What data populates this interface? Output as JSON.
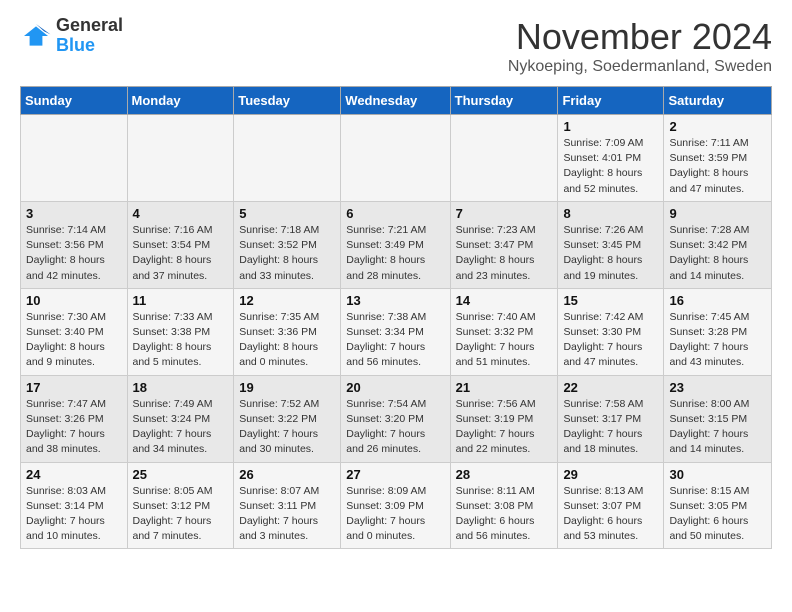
{
  "header": {
    "logo_line1": "General",
    "logo_line2": "Blue",
    "month_title": "November 2024",
    "location": "Nykoeping, Soedermanland, Sweden"
  },
  "weekdays": [
    "Sunday",
    "Monday",
    "Tuesday",
    "Wednesday",
    "Thursday",
    "Friday",
    "Saturday"
  ],
  "weeks": [
    [
      {
        "day": "",
        "info": ""
      },
      {
        "day": "",
        "info": ""
      },
      {
        "day": "",
        "info": ""
      },
      {
        "day": "",
        "info": ""
      },
      {
        "day": "",
        "info": ""
      },
      {
        "day": "1",
        "info": "Sunrise: 7:09 AM\nSunset: 4:01 PM\nDaylight: 8 hours and 52 minutes."
      },
      {
        "day": "2",
        "info": "Sunrise: 7:11 AM\nSunset: 3:59 PM\nDaylight: 8 hours and 47 minutes."
      }
    ],
    [
      {
        "day": "3",
        "info": "Sunrise: 7:14 AM\nSunset: 3:56 PM\nDaylight: 8 hours and 42 minutes."
      },
      {
        "day": "4",
        "info": "Sunrise: 7:16 AM\nSunset: 3:54 PM\nDaylight: 8 hours and 37 minutes."
      },
      {
        "day": "5",
        "info": "Sunrise: 7:18 AM\nSunset: 3:52 PM\nDaylight: 8 hours and 33 minutes."
      },
      {
        "day": "6",
        "info": "Sunrise: 7:21 AM\nSunset: 3:49 PM\nDaylight: 8 hours and 28 minutes."
      },
      {
        "day": "7",
        "info": "Sunrise: 7:23 AM\nSunset: 3:47 PM\nDaylight: 8 hours and 23 minutes."
      },
      {
        "day": "8",
        "info": "Sunrise: 7:26 AM\nSunset: 3:45 PM\nDaylight: 8 hours and 19 minutes."
      },
      {
        "day": "9",
        "info": "Sunrise: 7:28 AM\nSunset: 3:42 PM\nDaylight: 8 hours and 14 minutes."
      }
    ],
    [
      {
        "day": "10",
        "info": "Sunrise: 7:30 AM\nSunset: 3:40 PM\nDaylight: 8 hours and 9 minutes."
      },
      {
        "day": "11",
        "info": "Sunrise: 7:33 AM\nSunset: 3:38 PM\nDaylight: 8 hours and 5 minutes."
      },
      {
        "day": "12",
        "info": "Sunrise: 7:35 AM\nSunset: 3:36 PM\nDaylight: 8 hours and 0 minutes."
      },
      {
        "day": "13",
        "info": "Sunrise: 7:38 AM\nSunset: 3:34 PM\nDaylight: 7 hours and 56 minutes."
      },
      {
        "day": "14",
        "info": "Sunrise: 7:40 AM\nSunset: 3:32 PM\nDaylight: 7 hours and 51 minutes."
      },
      {
        "day": "15",
        "info": "Sunrise: 7:42 AM\nSunset: 3:30 PM\nDaylight: 7 hours and 47 minutes."
      },
      {
        "day": "16",
        "info": "Sunrise: 7:45 AM\nSunset: 3:28 PM\nDaylight: 7 hours and 43 minutes."
      }
    ],
    [
      {
        "day": "17",
        "info": "Sunrise: 7:47 AM\nSunset: 3:26 PM\nDaylight: 7 hours and 38 minutes."
      },
      {
        "day": "18",
        "info": "Sunrise: 7:49 AM\nSunset: 3:24 PM\nDaylight: 7 hours and 34 minutes."
      },
      {
        "day": "19",
        "info": "Sunrise: 7:52 AM\nSunset: 3:22 PM\nDaylight: 7 hours and 30 minutes."
      },
      {
        "day": "20",
        "info": "Sunrise: 7:54 AM\nSunset: 3:20 PM\nDaylight: 7 hours and 26 minutes."
      },
      {
        "day": "21",
        "info": "Sunrise: 7:56 AM\nSunset: 3:19 PM\nDaylight: 7 hours and 22 minutes."
      },
      {
        "day": "22",
        "info": "Sunrise: 7:58 AM\nSunset: 3:17 PM\nDaylight: 7 hours and 18 minutes."
      },
      {
        "day": "23",
        "info": "Sunrise: 8:00 AM\nSunset: 3:15 PM\nDaylight: 7 hours and 14 minutes."
      }
    ],
    [
      {
        "day": "24",
        "info": "Sunrise: 8:03 AM\nSunset: 3:14 PM\nDaylight: 7 hours and 10 minutes."
      },
      {
        "day": "25",
        "info": "Sunrise: 8:05 AM\nSunset: 3:12 PM\nDaylight: 7 hours and 7 minutes."
      },
      {
        "day": "26",
        "info": "Sunrise: 8:07 AM\nSunset: 3:11 PM\nDaylight: 7 hours and 3 minutes."
      },
      {
        "day": "27",
        "info": "Sunrise: 8:09 AM\nSunset: 3:09 PM\nDaylight: 7 hours and 0 minutes."
      },
      {
        "day": "28",
        "info": "Sunrise: 8:11 AM\nSunset: 3:08 PM\nDaylight: 6 hours and 56 minutes."
      },
      {
        "day": "29",
        "info": "Sunrise: 8:13 AM\nSunset: 3:07 PM\nDaylight: 6 hours and 53 minutes."
      },
      {
        "day": "30",
        "info": "Sunrise: 8:15 AM\nSunset: 3:05 PM\nDaylight: 6 hours and 50 minutes."
      }
    ]
  ]
}
